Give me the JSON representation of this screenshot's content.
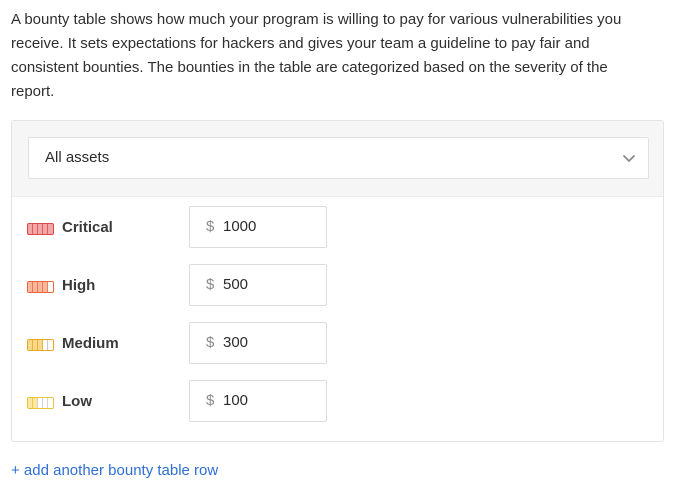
{
  "intro": {
    "text": "A bounty table shows how much your program is willing to pay for various vulnerabilities you receive. It sets expectations for hackers and gives your team a guideline to pay fair and consistent bounties. The bounties in the table are categorized based on the severity of the report."
  },
  "asset_filter": {
    "selected": "All assets",
    "icon": "chevron-down-icon"
  },
  "rows": [
    {
      "label": "Critical",
      "currency": "$",
      "amount": "1000",
      "color": "#e05252",
      "fill_level": 5
    },
    {
      "label": "High",
      "currency": "$",
      "amount": "500",
      "color": "#f07a55",
      "fill_level": 4
    },
    {
      "label": "Medium",
      "currency": "$",
      "amount": "300",
      "color": "#f2b33d",
      "fill_level": 3
    },
    {
      "label": "Low",
      "currency": "$",
      "amount": "100",
      "color": "#f3cf4a",
      "fill_level": 2
    }
  ],
  "add_row": {
    "label": "+ add another bounty table row"
  },
  "colors": {
    "link": "#2f6fd6",
    "panel_header_bg": "#f6f6f6"
  }
}
